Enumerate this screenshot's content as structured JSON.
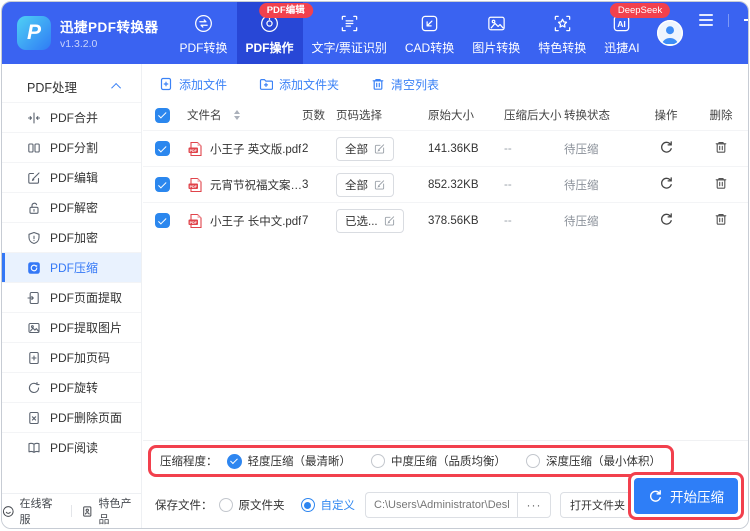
{
  "app": {
    "name": "迅捷PDF转换器",
    "version": "v1.3.2.0",
    "logo_letter": "P"
  },
  "header": {
    "tabs": [
      {
        "label": "PDF转换"
      },
      {
        "label": "PDF操作",
        "badge": "PDF编辑"
      },
      {
        "label": "文字/票证识别"
      },
      {
        "label": "CAD转换"
      },
      {
        "label": "图片转换"
      },
      {
        "label": "特色转换"
      },
      {
        "label": "迅捷AI",
        "badge": "DeepSeek",
        "icon_text": "AI"
      }
    ]
  },
  "sidebar": {
    "group_title": "PDF处理",
    "items": [
      {
        "label": "PDF合并"
      },
      {
        "label": "PDF分割"
      },
      {
        "label": "PDF编辑"
      },
      {
        "label": "PDF解密"
      },
      {
        "label": "PDF加密"
      },
      {
        "label": "PDF压缩"
      },
      {
        "label": "PDF页面提取"
      },
      {
        "label": "PDF提取图片"
      },
      {
        "label": "PDF加页码"
      },
      {
        "label": "PDF旋转"
      },
      {
        "label": "PDF删除页面"
      },
      {
        "label": "PDF阅读"
      }
    ],
    "footer": {
      "online_service": "在线客服",
      "featured_products": "特色产品"
    }
  },
  "toolbar": {
    "add_file": "添加文件",
    "add_folder": "添加文件夹",
    "clear_list": "清空列表"
  },
  "table": {
    "headers": {
      "name": "文件名",
      "pages": "页数",
      "page_select": "页码选择",
      "orig_size": "原始大小",
      "compressed_size": "压缩后大小",
      "status": "转换状态",
      "action": "操作",
      "delete": "删除"
    },
    "rows": [
      {
        "name": "小王子 英文版.pdf",
        "pages": "2",
        "page_select": "全部",
        "orig_size": "141.36KB",
        "compressed_size": "--",
        "status": "待压缩"
      },
      {
        "name": "元宵节祝福文案.pdf",
        "pages": "3",
        "page_select": "全部",
        "orig_size": "852.32KB",
        "compressed_size": "--",
        "status": "待压缩"
      },
      {
        "name": "小王子 长中文.pdf",
        "pages": "7",
        "page_select": "已选...",
        "orig_size": "378.56KB",
        "compressed_size": "--",
        "status": "待压缩"
      }
    ]
  },
  "compression": {
    "label": "压缩程度：",
    "selected_index": 0,
    "options": [
      {
        "label": "轻度压缩（最清晰）"
      },
      {
        "label": "中度压缩（品质均衡）"
      },
      {
        "label": "深度压缩（最小体积）"
      }
    ]
  },
  "save": {
    "label": "保存文件：",
    "original_option": "原文件夹",
    "custom_option": "自定义",
    "path": "C:\\Users\\Administrator\\Desktop",
    "browse": "···",
    "open_folder": "打开文件夹"
  },
  "actions": {
    "start": "开始压缩"
  },
  "colors": {
    "header_blue": "#3a63f1",
    "active_tab_blue": "#2847d6",
    "accent_blue": "#3b82f6",
    "badge_red": "#f2414d",
    "highlight_red": "#f2404d",
    "start_button_blue": "#2e7ef7",
    "sidebar_active_bg": "#e9f2fe"
  }
}
